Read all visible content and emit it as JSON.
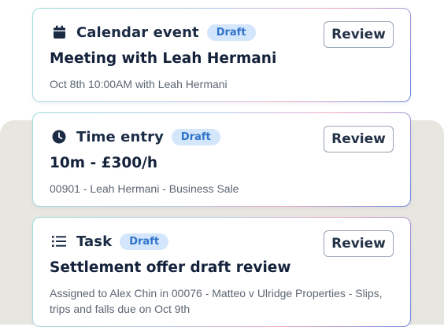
{
  "cards": [
    {
      "icon": "calendar-icon",
      "type_label": "Calendar event",
      "badge": "Draft",
      "review_label": "Review",
      "title": "Meeting with Leah Hermani",
      "subtitle": "Oct 8th 10:00AM with Leah Hermani"
    },
    {
      "icon": "clock-icon",
      "type_label": "Time entry",
      "badge": "Draft",
      "review_label": "Review",
      "title": "10m - £300/h",
      "subtitle": "00901 - Leah Hermani - Business Sale"
    },
    {
      "icon": "list-icon",
      "type_label": "Task",
      "badge": "Draft",
      "review_label": "Review",
      "title": "Settlement offer draft review",
      "subtitle": "Assigned to Alex Chin in 00076 - Matteo v Ulridge Properties - Slips, trips and falls due on Oct 9th"
    }
  ],
  "colors": {
    "icon": "#1b2b44",
    "badge_bg": "#d3e6fb",
    "badge_text": "#2f73c9",
    "backdrop": "#e8e6e1"
  }
}
